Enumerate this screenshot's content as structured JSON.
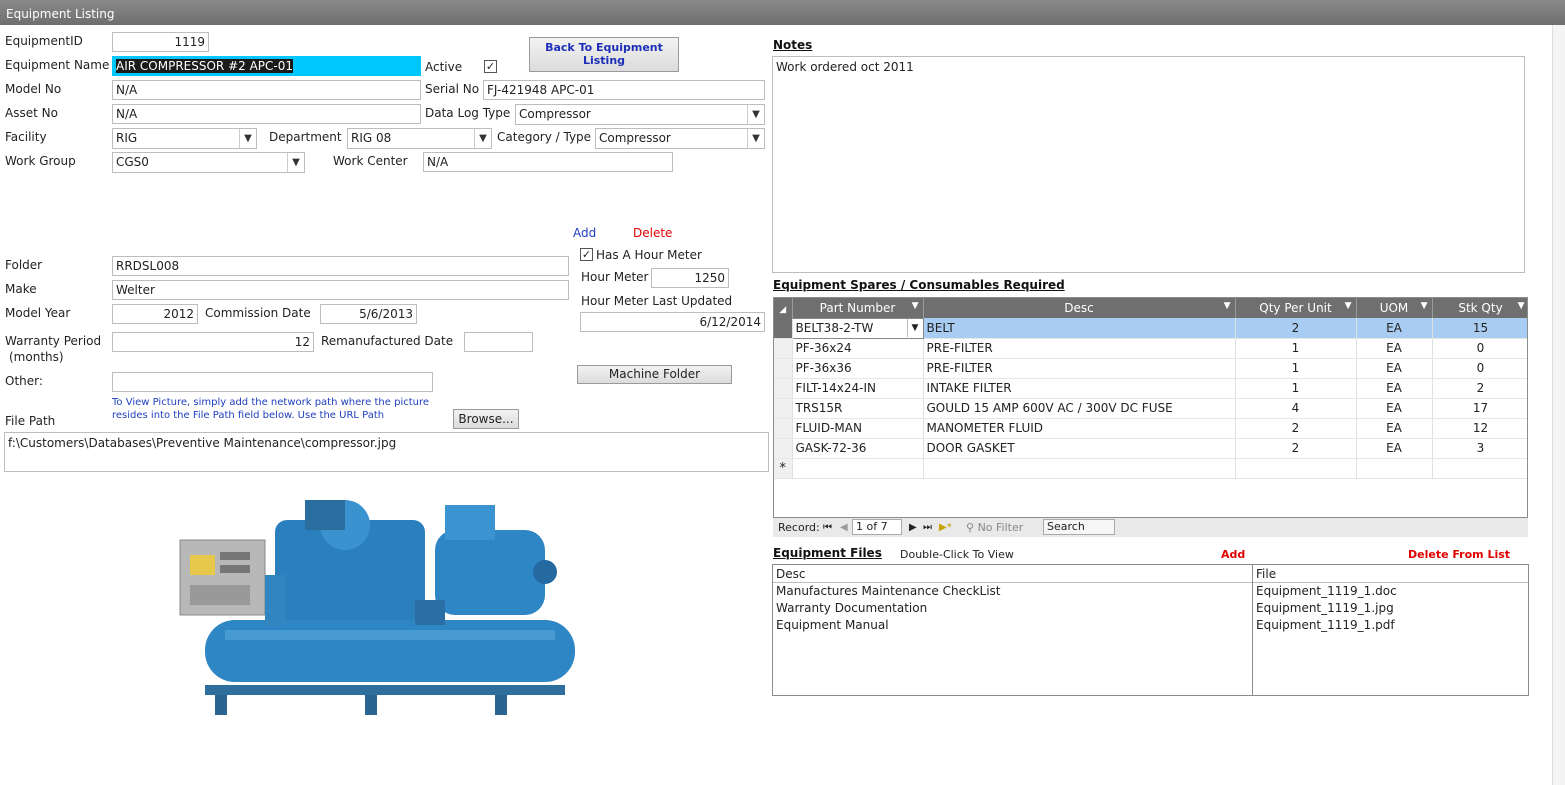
{
  "window": {
    "title": "Equipment Listing"
  },
  "form": {
    "equipment_id_label": "EquipmentID",
    "equipment_id": "1119",
    "equipment_name_label": "Equipment Name",
    "equipment_name": "AIR COMPRESSOR #2 APC-01",
    "active_label": "Active",
    "active_check": "✓",
    "back_button": "Back To Equipment Listing",
    "model_no_label": "Model No",
    "model_no": "N/A",
    "serial_no_label": "Serial No",
    "serial_no": "FJ-421948 APC-01",
    "asset_no_label": "Asset No",
    "asset_no": "N/A",
    "data_log_type_label": "Data Log Type",
    "data_log_type": "Compressor",
    "facility_label": "Facility",
    "facility": "RIG",
    "department_label": "Department",
    "department": "RIG 08",
    "category_label": "Category / Type",
    "category": "Compressor",
    "work_group_label": "Work Group",
    "work_group": "CGS0",
    "work_center_label": "Work Center",
    "work_center": "N/A",
    "add_link": "Add",
    "delete_link": "Delete",
    "hour_meter_check_label": "Has A Hour Meter",
    "hour_meter_check": "✓",
    "hour_meter_label": "Hour Meter",
    "hour_meter": "1250",
    "hour_meter_updated_label": "Hour Meter Last Updated",
    "hour_meter_updated": "6/12/2014",
    "folder_label": "Folder",
    "folder": "RRDSL008",
    "make_label": "Make",
    "make": "Welter",
    "model_year_label": "Model Year",
    "model_year": "2012",
    "commission_date_label": "Commission Date",
    "commission_date": "5/6/2013",
    "warranty_label": "Warranty Period",
    "warranty_sub": "(months)",
    "warranty": "12",
    "reman_date_label": "Remanufactured Date",
    "reman_date": "",
    "machine_folder_button": "Machine Folder",
    "other_label": "Other:",
    "other": "",
    "picture_hint_1": "To View Picture, simply add the network path where the picture",
    "picture_hint_2": "resides into the File Path field below. Use the URL Path",
    "browse_button": "Browse...",
    "file_path_label": "File Path",
    "file_path": "f:\\Customers\\Databases\\Preventive Maintenance\\compressor.jpg"
  },
  "notes": {
    "label": "Notes",
    "text": "Work ordered oct 2011"
  },
  "spares": {
    "label": "Equipment Spares / Consumables Required",
    "columns": [
      "Part Number",
      "Desc",
      "Qty Per Unit",
      "UOM",
      "Stk Qty"
    ],
    "rows": [
      [
        "BELT38-2-TW",
        "BELT",
        "2",
        "EA",
        "15"
      ],
      [
        "PF-36x24",
        "PRE-FILTER",
        "1",
        "EA",
        "0"
      ],
      [
        "PF-36x36",
        "PRE-FILTER",
        "1",
        "EA",
        "0"
      ],
      [
        "FILT-14x24-IN",
        "INTAKE FILTER",
        "1",
        "EA",
        "2"
      ],
      [
        "TRS15R",
        "GOULD 15 AMP 600V AC / 300V DC FUSE",
        "4",
        "EA",
        "17"
      ],
      [
        "FLUID-MAN",
        "MANOMETER FLUID",
        "2",
        "EA",
        "12"
      ],
      [
        "GASK-72-36",
        "DOOR GASKET",
        "2",
        "EA",
        "3"
      ]
    ],
    "new_row_marker": "*",
    "nav": {
      "record_label": "Record:",
      "position": "1 of 7",
      "filter": "No Filter",
      "search": "Search"
    }
  },
  "files": {
    "label": "Equipment Files",
    "hint": "Double-Click To View",
    "add_link": "Add",
    "delete_link": "Delete From List",
    "desc_header": "Desc",
    "file_header": "File",
    "rows": [
      {
        "desc": "Manufactures Maintenance CheckList",
        "file": "Equipment_1119_1.doc"
      },
      {
        "desc": "Warranty Documentation",
        "file": "Equipment_1119_1.jpg"
      },
      {
        "desc": "Equipment Manual",
        "file": "Equipment_1119_1.pdf"
      }
    ]
  },
  "colors": {
    "selection": "#00c8ff",
    "add_link": "#1f3fbf",
    "delete_link": "#e00000",
    "grid_header": "#6f6f6f",
    "grid_highlight": "#a9cdf2"
  }
}
